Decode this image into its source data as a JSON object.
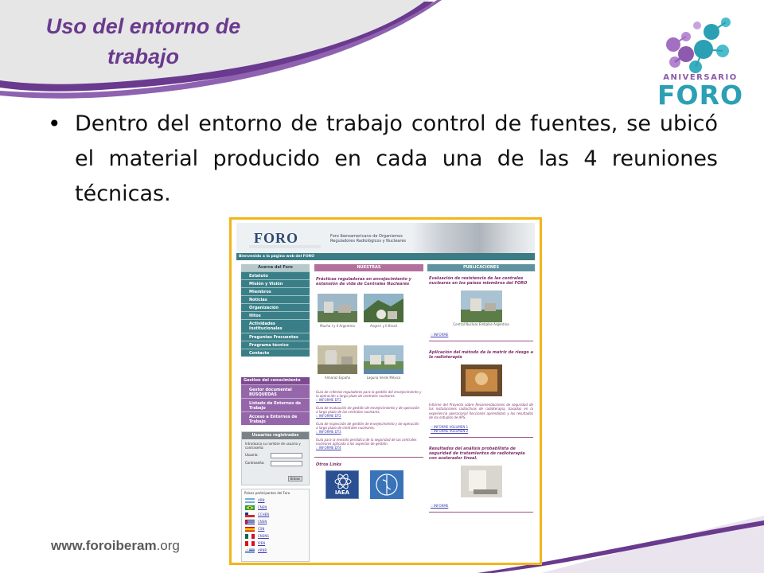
{
  "slide": {
    "title_line1": "Uso del entorno de",
    "title_line2": "trabajo",
    "bullet": "Dentro del entorno de trabajo control de fuentes, se ubicó el material producido en cada una de las 4 reuniones técnicas.",
    "logo_label": "ANIVERSARIO",
    "logo_word": "FORO",
    "footer_url_bold": "www.foroiberam",
    "footer_url_thin": ".org",
    "colors": {
      "title_purple": "#6a3a8e",
      "accent_teal": "#2ba0b4",
      "frame_gold": "#f2b51a"
    }
  },
  "site": {
    "logo": "FORO",
    "org_name": "Foro Iberoamericano de Organismos Reguladores Radiológicos y Nucleares",
    "welcome": "Bienvenido a la página web del FORO",
    "nav_header": "Acerca del Foro",
    "nav": [
      "Estatuto",
      "Misión y Visión",
      "Miembros",
      "Noticias",
      "Organización",
      "Hitos",
      "Actividades Institucionales",
      "Preguntas Frecuentes",
      "Programa técnico",
      "Contacto"
    ],
    "gestion_header": "Gestion del conocimiento",
    "gestion": [
      "Gestor documental BÚSQUEDAS",
      "Listado de Entornos de Trabajo",
      "Acceso a Entornos de Trabajo"
    ],
    "login": {
      "header": "Usuarios registrados",
      "note": "Introduzca su nombre de usuario y contraseña:",
      "user_label": "Usuario:",
      "pass_label": "Contraseña:",
      "button": "Entrar"
    },
    "countries_header": "Países participantes del Foro",
    "countries": [
      "ARN",
      "CNEN",
      "CCHEN",
      "CNSN",
      "CSN",
      "CNSNS",
      "IPEN",
      "ARNR"
    ],
    "col_mid_header": "NUESTRAS",
    "col_right_header": "PUBLICACIONES",
    "mid_title": "Prácticas reguladoras en envejecimiento y extensión de vida de Centrales Nucleares",
    "captions": [
      "Mucha I y II Argentina",
      "Angra I y II Brasil",
      "Almaraz España",
      "Laguna Verde México"
    ],
    "guides": [
      {
        "text": "Guía de criterios reguladores para la gestión del envejecimiento y la operación a largo plazo de centrales nucleares.",
        "link": ":: INFORME DT1"
      },
      {
        "text": "Guía de evaluación de gestión de envejecimiento y de operación a largo plazo de las centrales nucleares.",
        "link": ":: INFORME DT2"
      },
      {
        "text": "Guía de inspección de gestión de envejecimiento y de operación a largo plazo de centrales nucleares.",
        "link": ":: INFORME DT3"
      },
      {
        "text": "Guía para la revisión periódica de la seguridad de las centrales nucleares aplicada a los aspectos de gestión.",
        "link": ":: INFORME DT4"
      }
    ],
    "otros_links": "Otros Links",
    "org_logos": [
      "IAEA",
      "WHO"
    ],
    "right": {
      "pub1_title": "Evaluación de resistencia de las centrales nucleares en los países miembros del FORO",
      "pub1_caption": "Central Nuclear Embalse Argentina",
      "pub1_link": ":: INFORME",
      "pub2_title": "Aplicación del método de la matriz de riesgo a la radioterapia",
      "pub2_body": "Informe del Proyecto sobre Recomendaciones de seguridad de las instalaciones radiactivas de radioterapia, basadas en la experiencia operacional (lecciones aprendidas) y los resultados de los estudios de APS.",
      "pub2_link1": ":: INFORME VOLUMEN 1",
      "pub2_link2": ":: INFORME VOLUMEN 2",
      "pub3_title": "Resultados del análisis probabilista de seguridad de tratamientos de radioterapia con acelerador lineal.",
      "pub3_link": ":: INFORME"
    }
  }
}
